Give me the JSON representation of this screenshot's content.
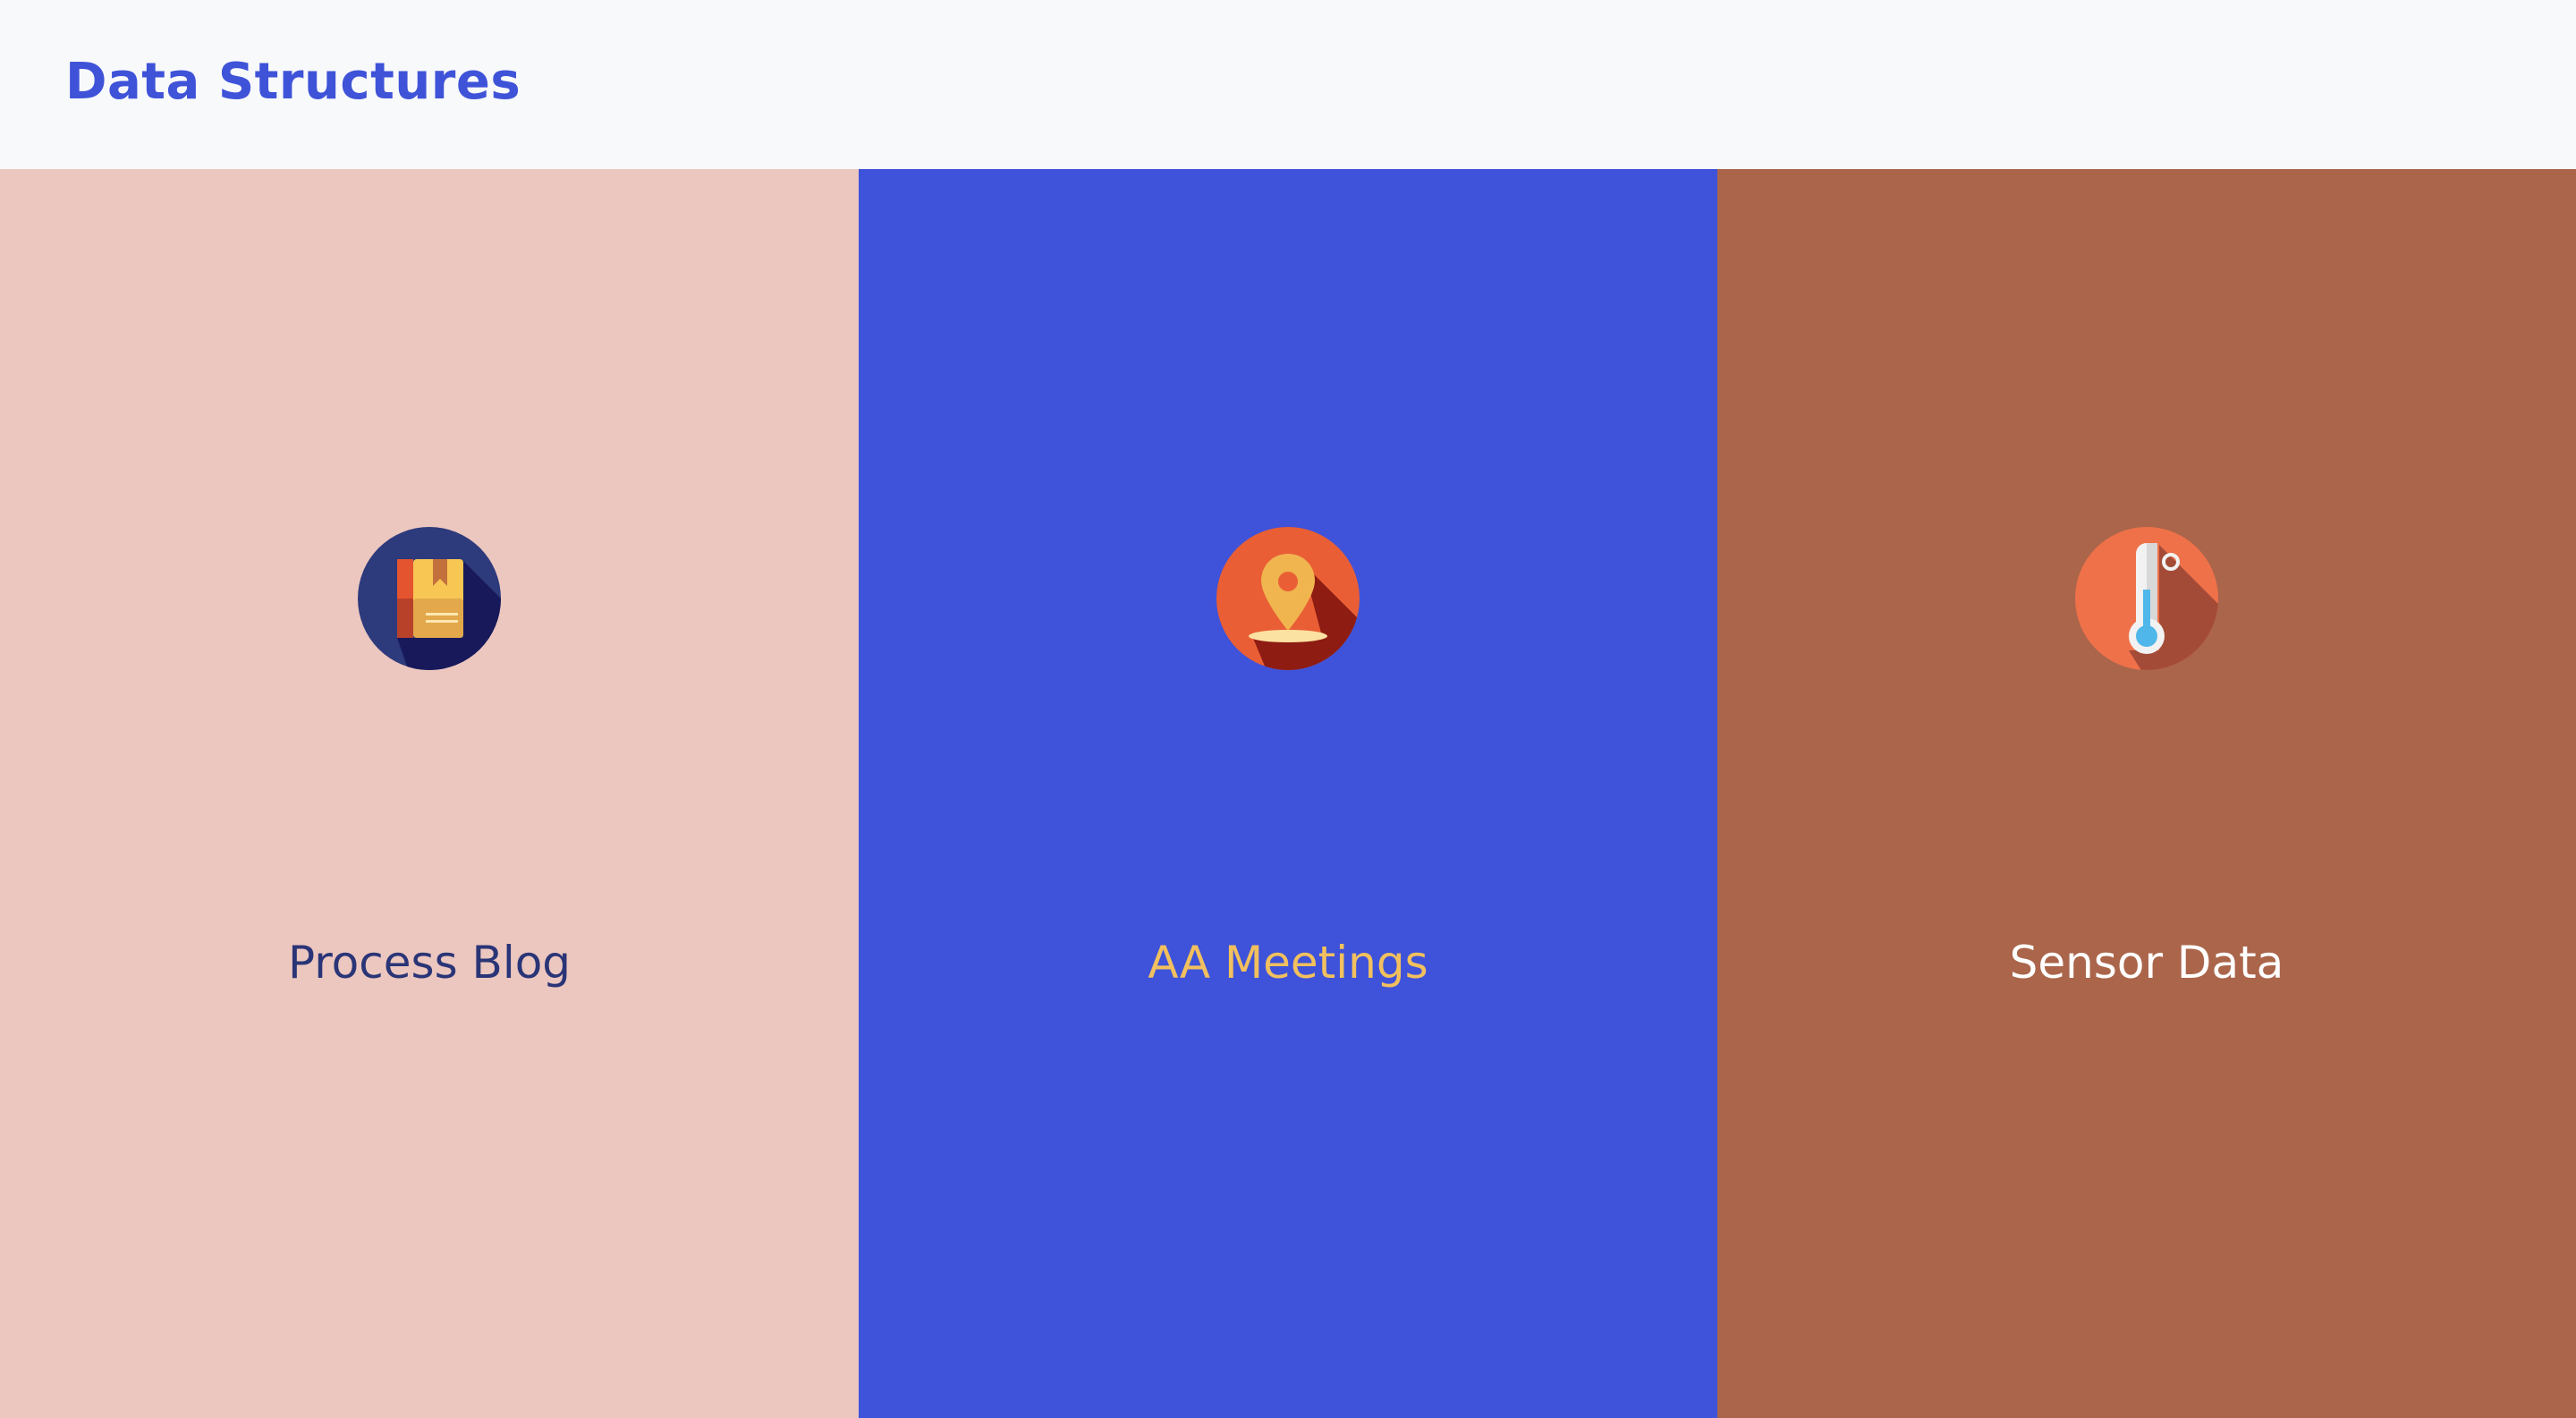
{
  "header": {
    "title": "Data Structures"
  },
  "panels": [
    {
      "label": "Process Blog",
      "icon": "book-icon",
      "background": "#ecc7bf",
      "text_color": "#2a3577"
    },
    {
      "label": "AA Meetings",
      "icon": "map-pin-icon",
      "background": "#3e53d9",
      "text_color": "#f2c05e"
    },
    {
      "label": "Sensor Data",
      "icon": "thermometer-icon",
      "background": "#aa654a",
      "text_color": "#ffffff"
    }
  ],
  "colors": {
    "accent": "#3f53d8",
    "header_bg": "#f8f9fb"
  }
}
